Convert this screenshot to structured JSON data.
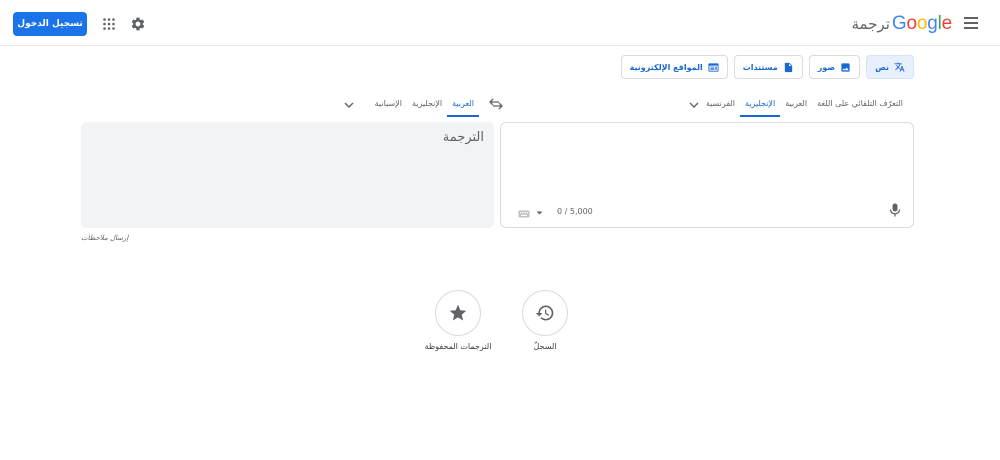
{
  "header": {
    "signin_label": "تسجيل الدخول",
    "logo_text": "Google",
    "product_name": "ترجمة"
  },
  "modes": [
    {
      "label": "نص",
      "icon": "translate-icon",
      "active": true
    },
    {
      "label": "صور",
      "icon": "image-icon",
      "active": false
    },
    {
      "label": "مستندات",
      "icon": "document-icon",
      "active": false
    },
    {
      "label": "المواقع الإلكترونية",
      "icon": "website-icon",
      "active": false
    }
  ],
  "source_languages": {
    "detect": "التعرّف التلقائي على اللغة",
    "items": [
      "العربية",
      "الإنجليزية",
      "الفرنسية"
    ],
    "active_index": 1
  },
  "target_languages": {
    "items": [
      "العربية",
      "الإنجليزية",
      "الإسبانية"
    ],
    "active_index": 0
  },
  "source_panel": {
    "char_counter": "0 / 5,000"
  },
  "output_panel": {
    "placeholder": "الترجمة"
  },
  "feedback_label": "إرسال ملاحظات",
  "bottom_actions": {
    "history_label": "السجلّ",
    "saved_label": "الترجمات المحفوظة"
  },
  "colors": {
    "accent": "#1a73e8",
    "active_tab": "#1967d2",
    "output_bg": "#f1f3f4"
  }
}
